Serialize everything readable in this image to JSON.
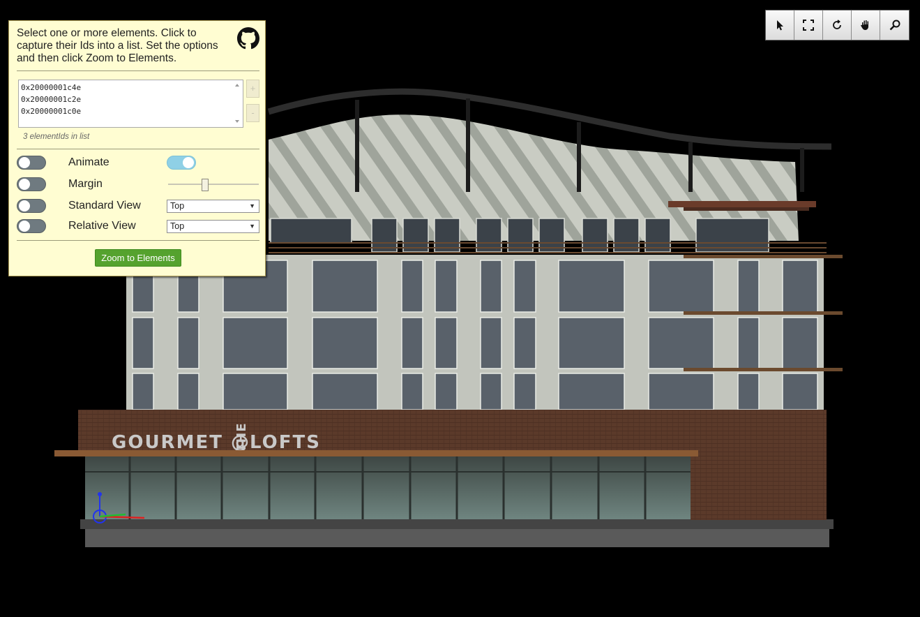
{
  "panel": {
    "instructions": "Select one or more elements. Click to capture their Ids into a list. Set the options and then click Zoom to Elements.",
    "element_ids": [
      "0x20000001c4e",
      "0x20000001c2e",
      "0x20000001c0e"
    ],
    "add_label": "+",
    "remove_label": "-",
    "count_text": "3 elementIds in list",
    "options": {
      "animate": {
        "label": "Animate",
        "enabled": false,
        "value_on": true
      },
      "margin": {
        "label": "Margin",
        "enabled": false,
        "value_fraction": 0.4
      },
      "standard_view": {
        "label": "Standard View",
        "enabled": false,
        "selected": "Top"
      },
      "relative_view": {
        "label": "Relative View",
        "enabled": false,
        "selected": "Top"
      }
    },
    "zoom_button": "Zoom to Elements"
  },
  "toolbar": {
    "tools": [
      "select-arrow-icon",
      "fit-view-icon",
      "rotate-icon",
      "pan-hand-icon",
      "zoom-magnifier-icon"
    ]
  },
  "scene": {
    "sign_text_left": "GOURMET @",
    "sign_text_vertical": "THE",
    "sign_text_right": "LOFTS"
  }
}
